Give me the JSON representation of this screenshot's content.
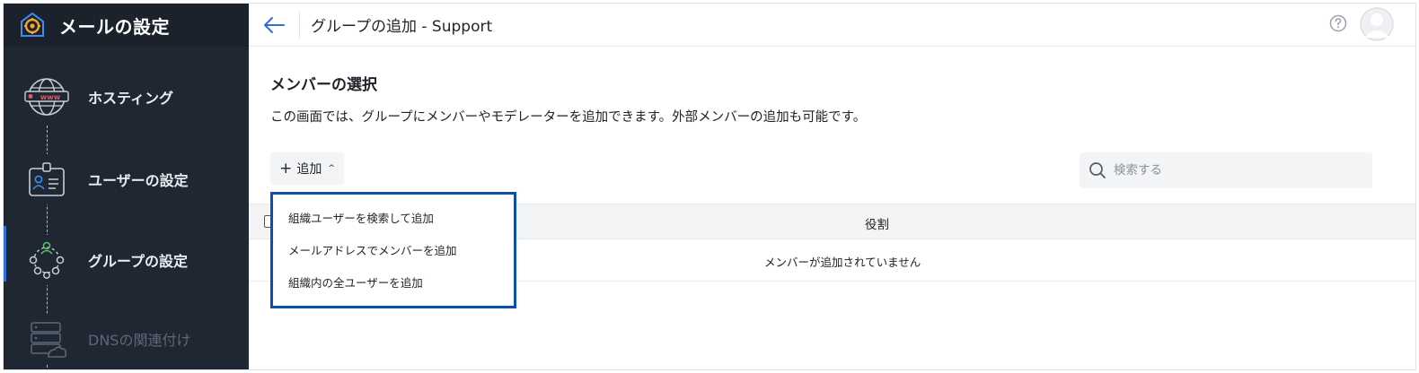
{
  "app": {
    "title": "メールの設定"
  },
  "sidebar": {
    "steps": [
      {
        "label": "ホスティング",
        "icon": "globe-www-icon",
        "state": "done"
      },
      {
        "label": "ユーザーの設定",
        "icon": "user-card-icon",
        "state": "done"
      },
      {
        "label": "グループの設定",
        "icon": "group-network-icon",
        "state": "active"
      },
      {
        "label": "DNSの関連付け",
        "icon": "server-cloud-icon",
        "state": "disabled"
      }
    ]
  },
  "header": {
    "title": "グループの追加 - Support",
    "back_icon": "arrow-left-icon",
    "help_icon": "question-circle-icon",
    "avatar_icon": "user-avatar-icon"
  },
  "main": {
    "section_title": "メンバーの選択",
    "description": "この画面では、グループにメンバーやモデレーターを追加できます。外部メンバーの追加も可能です。",
    "add_button": {
      "label": "追加",
      "plus": "+",
      "chevron": "^"
    },
    "search": {
      "placeholder": "検索する"
    },
    "table": {
      "columns": [
        "役割"
      ],
      "empty_text": "メンバーが追加されていません"
    },
    "dropdown": {
      "items": [
        "組織ユーザーを検索して追加",
        "メールアドレスでメンバーを追加",
        "組織内の全ユーザーを追加"
      ]
    }
  },
  "colors": {
    "sidebar_bg": "#1f2732",
    "accent": "#2f6fd6",
    "dropdown_border": "#0b4fb0",
    "logo_orange": "#f5a623"
  }
}
